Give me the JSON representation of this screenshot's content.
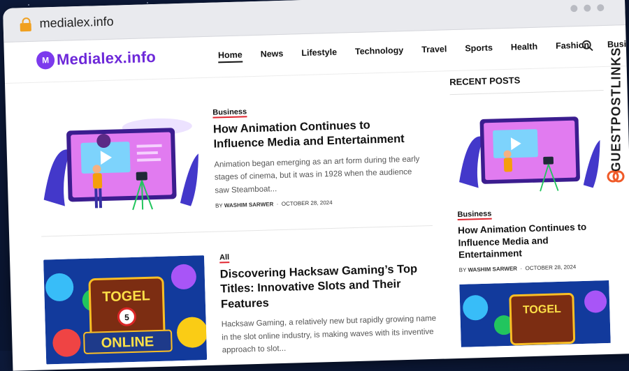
{
  "browser": {
    "url": "medialex.info"
  },
  "site": {
    "logo_text": "Medialex.info",
    "logo_mark": "M",
    "nav": [
      "Home",
      "News",
      "Lifestyle",
      "Technology",
      "Travel",
      "Sports",
      "Health",
      "Fashion",
      "Business"
    ]
  },
  "posts": [
    {
      "category": "Business",
      "title": "How Animation Continues to Influence Media and Entertainment",
      "excerpt": "Animation began emerging as an art form during the early stages of cinema, but it was in 1928 when the audience saw Steamboat...",
      "by": "BY",
      "author": "WASHIM SARWER",
      "date": "OCTOBER 28, 2024"
    },
    {
      "category": "All",
      "title": "Discovering Hacksaw Gaming’s Top Titles: Innovative Slots and Their Features",
      "excerpt": "Hacksaw Gaming, a relatively new but rapidly growing name in the slot online industry, is making waves with its inventive approach to slot..."
    }
  ],
  "sidebar": {
    "title": "RECENT POSTS",
    "post": {
      "category": "Business",
      "title": "How Animation Continues to Influence Media and Entertainment",
      "by": "BY",
      "author": "WASHIM SARWER",
      "date": "OCTOBER 28, 2024"
    }
  },
  "banner": {
    "text": "GUESTPOSTLINKS"
  },
  "thumb_text": {
    "line1": "TOGEL",
    "line2": "ONLINE"
  },
  "colors": {
    "accent": "#e0242e",
    "brand": "#6d28d9",
    "banner_icon": "#f05a28"
  }
}
